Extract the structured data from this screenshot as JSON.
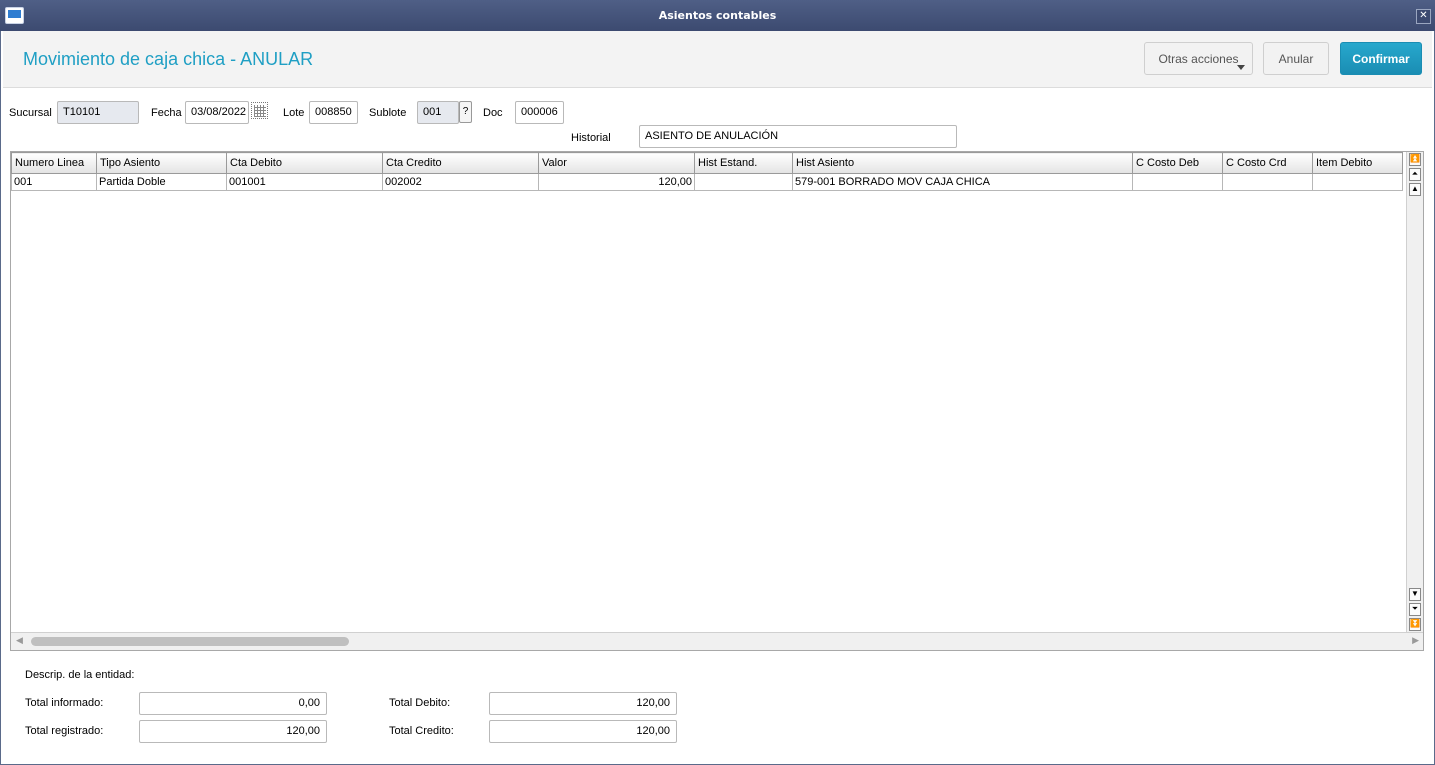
{
  "window": {
    "title": "Asientos contables"
  },
  "header": {
    "page_title": "Movimiento de caja chica - ANULAR",
    "buttons": {
      "otras": "Otras acciones",
      "anular": "Anular",
      "confirmar": "Confirmar"
    },
    "accent_color": "#1f9fc4"
  },
  "form": {
    "sucursal_label": "Sucursal",
    "sucursal_value": "T10101",
    "fecha_label": "Fecha",
    "fecha_value": "03/08/2022",
    "lote_label": "Lote",
    "lote_value": "008850",
    "sublote_label": "Sublote",
    "sublote_value": "001",
    "help_label": "?",
    "doc_label": "Doc",
    "doc_value": "000006",
    "historial_label": "Historial",
    "historial_value": "ASIENTO DE ANULACIÓN"
  },
  "grid": {
    "columns": [
      "Numero Linea",
      "Tipo Asiento",
      "Cta Debito",
      "Cta Credito",
      "Valor",
      "Hist Estand.",
      "Hist Asiento",
      "C Costo Deb",
      "C Costo Crd",
      "Item Debito"
    ],
    "rows": [
      [
        "001",
        "Partida Doble",
        "001001",
        "002002",
        "120,00",
        "",
        "579-001 BORRADO MOV CAJA CHICA",
        "",
        "",
        ""
      ]
    ]
  },
  "footer": {
    "descrip_label": "Descrip. de la entidad:",
    "total_informado_label": "Total informado:",
    "total_informado_value": "0,00",
    "total_registrado_label": "Total registrado:",
    "total_registrado_value": "120,00",
    "total_debito_label": "Total Debito:",
    "total_debito_value": "120,00",
    "total_credito_label": "Total Credito:",
    "total_credito_value": "120,00"
  }
}
